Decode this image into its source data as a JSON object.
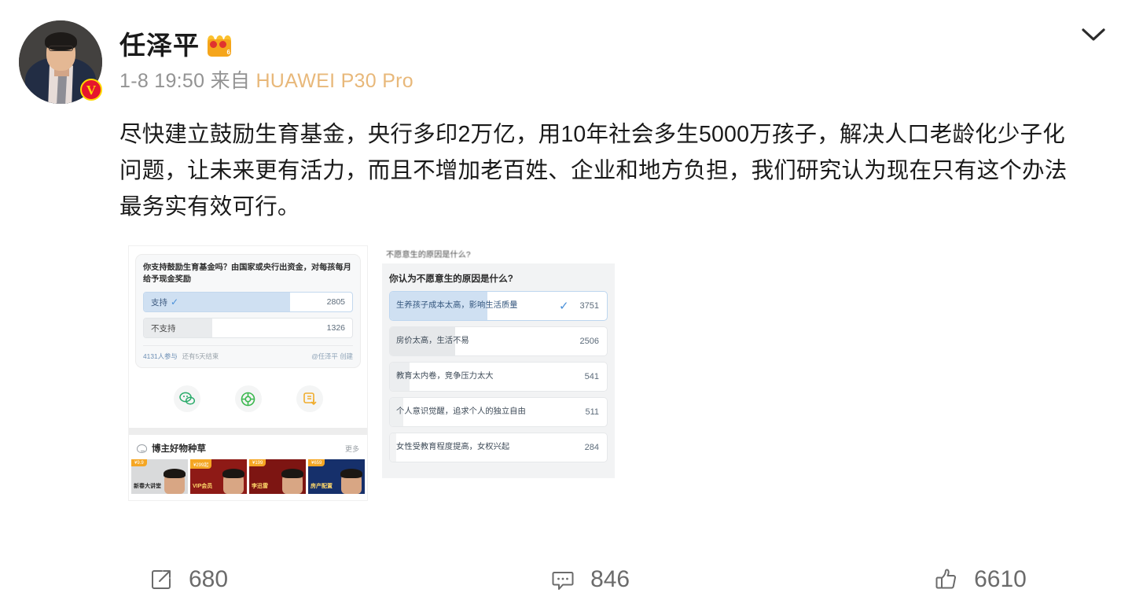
{
  "post": {
    "author": {
      "name": "任泽平",
      "badge_icon": "crown-badge-icon",
      "badge_level": "6",
      "verified_mark": "V",
      "avatar_icon": "avatar-photo"
    },
    "meta": {
      "timestamp": "1-8 19:50",
      "from_label": "来自",
      "source": "HUAWEI P30 Pro"
    },
    "content": "尽快建立鼓励生育基金，央行多印2万亿，用10年社会多生5000万孩子，解决人口老龄化少子化问题，让未来更有活力，而且不增加老百姓、企业和地方负担，我们研究认为现在只有这个办法最务实有效可行。",
    "collapse_icon": "chevron-down-icon"
  },
  "media": {
    "poll_screenshot": {
      "question": "你支持鼓励生育基金吗？由国家或央行出资金，对每孩每月给予现金奖励",
      "options": [
        {
          "label": "支持",
          "value": "2805",
          "selected": true,
          "check_icon": "check-icon"
        },
        {
          "label": "不支持",
          "value": "1326",
          "selected": false
        }
      ],
      "participants": "4131人参与",
      "remaining": "还有5天结束",
      "creator": "@任泽平 创建",
      "share_icons": [
        "wechat-icon",
        "wechat-moments-icon",
        "weibo-repost-icon"
      ],
      "product_bar": {
        "icon": "sprout-icon",
        "title": "博主好物种草",
        "more": "更多"
      },
      "thumbnails": [
        {
          "tag": "¥9.9",
          "text": "新春大讲堂",
          "theme": "light"
        },
        {
          "tag": "¥299起",
          "text": "VIP会员",
          "theme": "red"
        },
        {
          "tag": "¥199",
          "text": "李迅雷",
          "theme": "darkred"
        },
        {
          "tag": "¥659",
          "text": "房产配置",
          "theme": "blue"
        }
      ]
    },
    "survey_screenshot": {
      "caption": "不愿意生的原因是什么?",
      "title": "你认为不愿意生的原因是什么?",
      "options": [
        {
          "label": "生养孩子成本太高，影响生活质量",
          "value": "3751",
          "selected": true,
          "check_icon": "check-icon"
        },
        {
          "label": "房价太高，生活不易",
          "value": "2506",
          "selected": false
        },
        {
          "label": "教育太内卷，竞争压力太大",
          "value": "541",
          "selected": false
        },
        {
          "label": "个人意识觉醒，追求个人的独立自由",
          "value": "511",
          "selected": false
        },
        {
          "label": "女性受教育程度提高，女权兴起",
          "value": "284",
          "selected": false
        }
      ]
    }
  },
  "actions": [
    {
      "name": "repost",
      "icon": "repost-icon",
      "count": "680"
    },
    {
      "name": "comment",
      "icon": "comment-icon",
      "count": "846"
    },
    {
      "name": "like",
      "icon": "thumbs-up-icon",
      "count": "6610"
    }
  ],
  "colors": {
    "accent_blue": "#4a90d9",
    "poll_fill": "#cfe0f2",
    "verified_red": "#e6162d",
    "source_orange": "#e8b87a",
    "text_primary": "#1a1a1a",
    "text_muted": "#939393"
  }
}
